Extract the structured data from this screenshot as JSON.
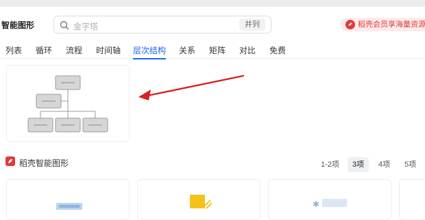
{
  "app": {
    "title": "智能图形"
  },
  "search": {
    "placeholder": "金字塔",
    "toggle_label": "并列"
  },
  "promo": {
    "text": "稻壳会员享海量资源"
  },
  "tabs": [
    {
      "label": "列表"
    },
    {
      "label": "循环"
    },
    {
      "label": "流程"
    },
    {
      "label": "时间轴"
    },
    {
      "label": "层次结构",
      "active": true
    },
    {
      "label": "关系"
    },
    {
      "label": "矩阵"
    },
    {
      "label": "对比"
    },
    {
      "label": "免费"
    }
  ],
  "section": {
    "title": "稻壳智能图形"
  },
  "filters": [
    {
      "label": "1-2项"
    },
    {
      "label": "3项",
      "active": true
    },
    {
      "label": "4项"
    },
    {
      "label": "5项"
    }
  ],
  "colors": {
    "accent": "#1b64f2",
    "promo_red": "#e03b3b",
    "arrow_red": "#d9201e"
  }
}
